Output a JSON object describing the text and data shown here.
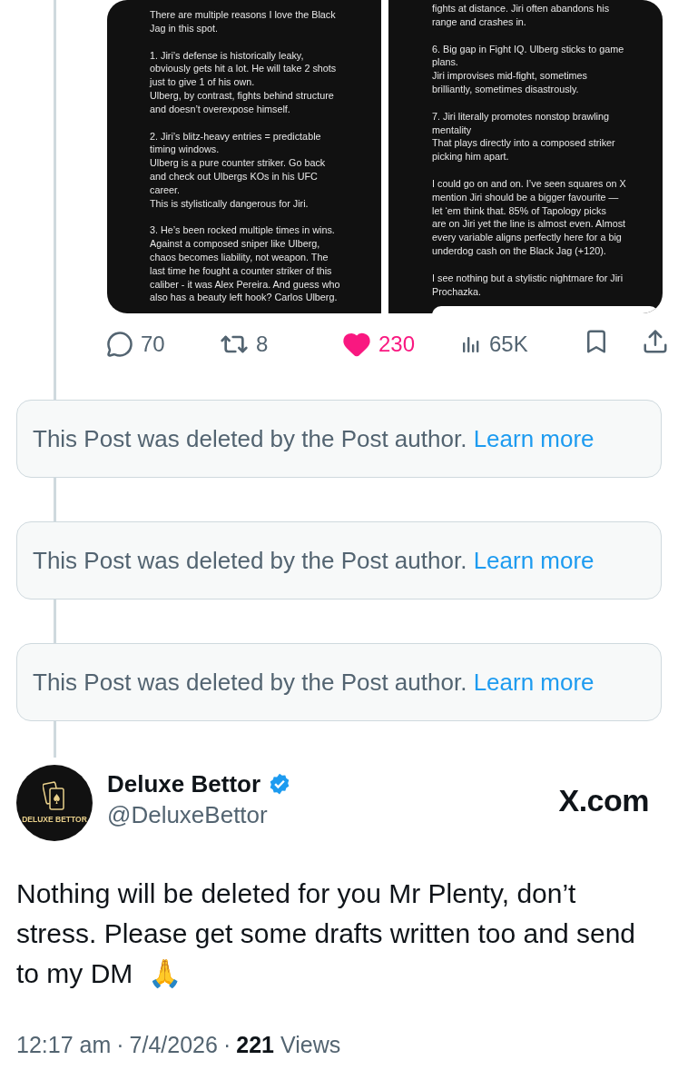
{
  "attached_images": [
    {
      "paragraphs": [
        "There are multiple reasons I love the Black\nJag in this spot.",
        "1. Jiri’s defense is historically leaky,\nobviously gets hit a lot. He will take 2 shots\njust to give 1 of his own.\nUlberg, by contrast, fights behind structure\nand doesn’t overexpose himself.",
        "2. Jiri’s blitz-heavy entries = predictable\ntiming windows.\nUlberg is a pure counter striker. Go back\nand check out Ulbergs KOs in his UFC\ncareer.\nThis is stylistically dangerous for Jiri.",
        "3. He’s been rocked multiple times in wins.\nAgainst a composed sniper like Ulberg,\nchaos becomes liability, not weapon. The\nlast time he fought a counter striker of this\ncaliber - it was Alex Pereira. And guess who\nalso has a beauty left hook? Carlos Ulberg."
      ]
    },
    {
      "paragraphs": [
        "fights at distance. Jiri often abandons his\nrange and crashes in.",
        "6. Big gap in Fight IQ. Ulberg sticks to game\nplans.\nJiri improvises mid-fight, sometimes\nbrilliantly, sometimes disastrously.",
        "7. Jiri literally promotes nonstop brawling\nmentality\nThat plays directly into a composed striker\npicking him apart.",
        "I could go on and on. I’ve seen squares on X\nmention Jiri should be a bigger favourite —\nlet ‘em think that. 85% of Tapology picks\nare on Jiri yet the line is almost even. Almost\nevery variable aligns perfectly here for a big\nunderdog cash on the Black Jag (+120).",
        "I see nothing but a stylistic nightmare for Jiri\nProchazka."
      ]
    }
  ],
  "actions": [
    {
      "kind": "reply",
      "count": "70"
    },
    {
      "kind": "repost",
      "count": "8"
    },
    {
      "kind": "like",
      "count": "230",
      "liked": true
    },
    {
      "kind": "views",
      "count": "65K"
    },
    {
      "kind": "bookmark"
    },
    {
      "kind": "share"
    }
  ],
  "deleted_posts": [
    {
      "text": "This Post was deleted by the Post author.",
      "link": "Learn more"
    },
    {
      "text": "This Post was deleted by the Post author.",
      "link": "Learn more"
    },
    {
      "text": "This Post was deleted by the Post author.",
      "link": "Learn more"
    }
  ],
  "post": {
    "avatar_text": "DELUXE BETTOR",
    "name": "Deluxe Bettor",
    "verified": true,
    "handle": "@DeluxeBettor",
    "source": "X.com",
    "text": "Nothing will be deleted for you Mr Plenty, don’t stress. Please get some drafts written too and send to my DM  🙏",
    "time": "12:17 am",
    "separator": "·",
    "date": "7/4/2026",
    "views": "221",
    "views_label": "Views"
  }
}
